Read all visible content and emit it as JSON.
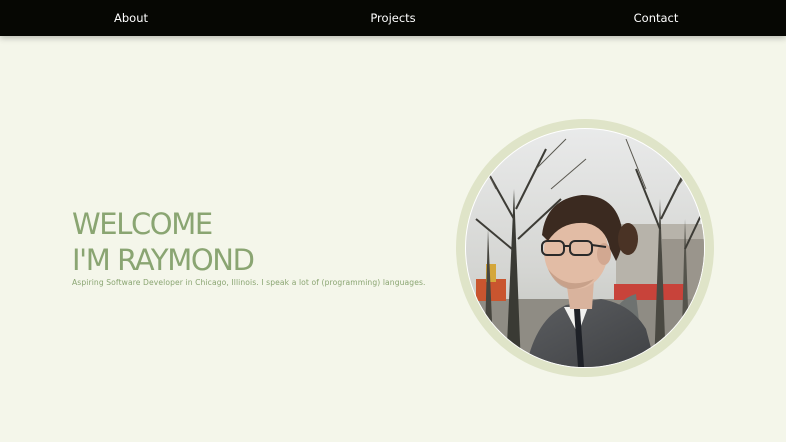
{
  "nav": {
    "about": "About",
    "projects": "Projects",
    "contact": "Contact"
  },
  "hero": {
    "line1": "WELCOME",
    "line2": "I'M RAYMOND",
    "tagline": "Aspiring Software Developer in Chicago, Illinois. I speak a lot of (programming) languages."
  },
  "portrait": {
    "icon": "profile-photo"
  },
  "colors": {
    "nav_background": "#060703",
    "page_background": "#f4f6ea",
    "accent_green": "#8aa572",
    "ring": "#dfe4c8"
  }
}
